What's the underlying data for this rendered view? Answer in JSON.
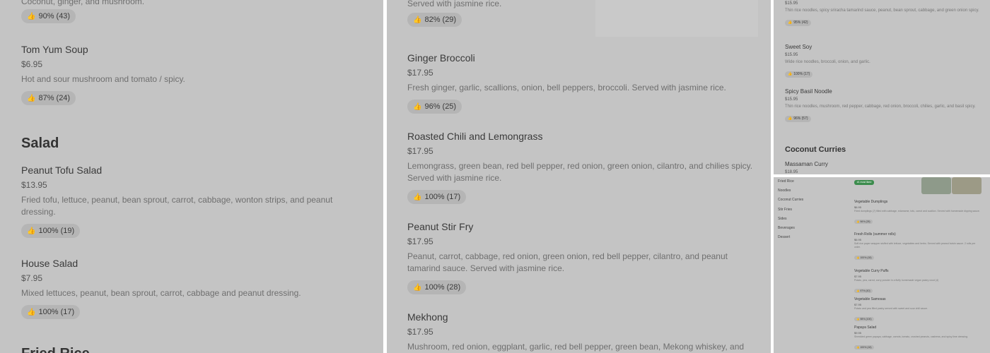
{
  "p1": {
    "top_cut_desc": "Coconut, ginger, and mushroom.",
    "top_cut_rating": "90% (43)",
    "items": [
      {
        "name": "Tom Yum Soup",
        "price": "$6.95",
        "desc": "Hot and sour mushroom and tomato / spicy.",
        "rating": "87% (24)"
      },
      {
        "name": "Peanut Tofu Salad",
        "price": "$13.95",
        "desc": "Fried tofu, lettuce, peanut, bean sprout, carrot, cabbage, wonton strips, and peanut dressing.",
        "rating": "100% (19)"
      },
      {
        "name": "House Salad",
        "price": "$7.95",
        "desc": "Mixed lettuces, peanut, bean sprout, carrot, cabbage and peanut dressing.",
        "rating": "100% (17)"
      }
    ],
    "section_salad": "Salad",
    "bottom_cut": "Fried Rice"
  },
  "p2": {
    "top_cut_desc": "Served with jasmine rice.",
    "top_cut_rating": "82% (29)",
    "items": [
      {
        "name": "Ginger Broccoli",
        "price": "$17.95",
        "desc": "Fresh ginger, garlic, scallions, onion, bell peppers, broccoli. Served with jasmine rice.",
        "rating": "96% (25)"
      },
      {
        "name": "Roasted Chili and Lemongrass",
        "price": "$17.95",
        "desc": "Lemongrass, green bean, red bell pepper, red onion, green onion, cilantro, and chilies spicy. Served with jasmine rice.",
        "rating": "100% (17)"
      },
      {
        "name": "Peanut Stir Fry",
        "price": "$17.95",
        "desc": "Peanut, carrot, cabbage, red onion, green onion, red bell pepper, cilantro, and peanut tamarind sauce. Served with jasmine rice.",
        "rating": "100% (28)"
      },
      {
        "name": "Mekhong",
        "price": "$17.95",
        "desc": "Mushroom, red onion, eggplant, garlic, red bell pepper, green bean, Mekong whiskey, and",
        "rating": ""
      }
    ]
  },
  "p3": {
    "top_price": "$15.95",
    "top_desc": "Thin rice noodles, spicy sriracha tamarind sauce, peanut, bean sprout, cabbage, and green onion spicy.",
    "top_rating": "95% (42)",
    "items": [
      {
        "name": "Sweet Soy",
        "price": "$15.95",
        "desc": "Wide rice noodles, broccoli, onion, and garlic.",
        "rating": "100% (17)"
      },
      {
        "name": "Spicy Basil Noodle",
        "price": "$15.95",
        "desc": "Thin rice noodles, mushroom, red pepper, cabbage, red onion, broccoli, chilies, garlic, and basil spicy.",
        "rating": "96% (57)"
      }
    ],
    "section": "Coconut Curries",
    "last_name": "Massaman Curry",
    "last_price": "$18.95"
  },
  "p4": {
    "nav": [
      "Fried Rice",
      "Noodles",
      "Coconut Curries",
      "Stir Fries",
      "Sides",
      "Beverages",
      "Dessert"
    ],
    "tag": "#1 most liked",
    "items": [
      {
        "name": "Vegetable Dumplings",
        "price": "$6.95",
        "desc": "Fried dumplings (7) filled with cabbage, edamame, tofu, carrot and scallion. Served with homemade dipping sauce.",
        "rating": "96% (28)"
      },
      {
        "name": "Fresh Rolls (summer rolls)",
        "price": "$6.95",
        "desc": "Soft rice paper wrapper stuffed with lettuce, vegetables and herbs. Served with peanut hoisin sauce. 2 rolls per order.",
        "rating": "100% (18)"
      },
      {
        "name": "Vegetable Curry Puffs",
        "price": "$7.95",
        "desc": "Potato, pea, carrot, curry powder in a fluffy homemade vegan pastry crust (4)",
        "rating": "97% (40)"
      },
      {
        "name": "Vegetable Samosas",
        "price": "$7.95",
        "desc": "Potato and pea filled pastry served with sweet and sour chili sauce.",
        "rating": "98% (100)"
      },
      {
        "name": "Papaya Salad",
        "price": "$9.95",
        "desc": "Shredded green papaya, cabbage, carrots, tomato, crushed peanuts, cashews, and spicy lime dressing.",
        "rating": "100% (18)"
      }
    ]
  }
}
